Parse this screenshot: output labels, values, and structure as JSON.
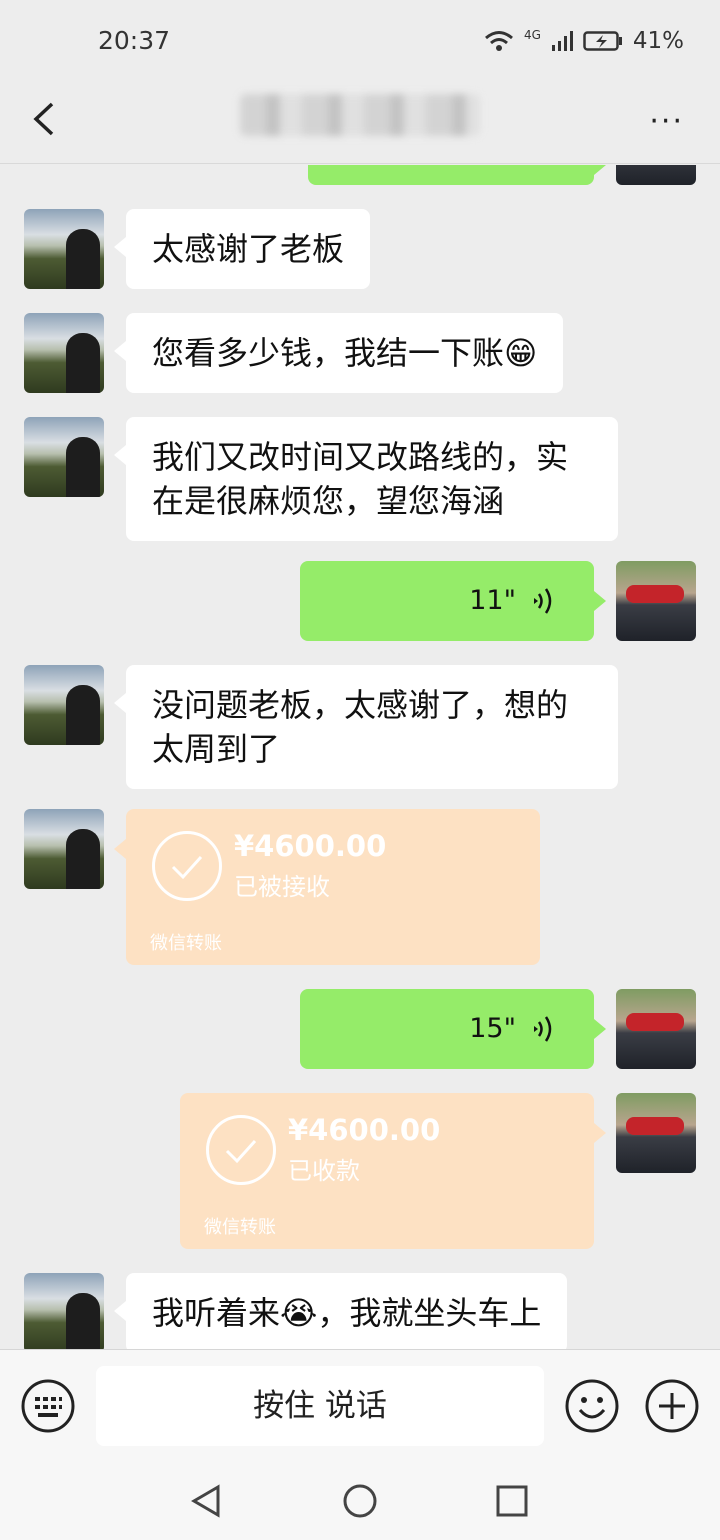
{
  "status_bar": {
    "time": "20:37",
    "network": "4G",
    "battery": "41%"
  },
  "header": {
    "back_icon": "chevron-left-icon",
    "more_label": "···"
  },
  "messages": [
    {
      "from": "other",
      "type": "text",
      "text": "太感谢了老板"
    },
    {
      "from": "other",
      "type": "text",
      "text": "您看多少钱，我结一下账😁"
    },
    {
      "from": "other",
      "type": "text",
      "text": "我们又改时间又改路线的，实在是很麻烦您，望您海涵"
    },
    {
      "from": "self",
      "type": "voice",
      "duration": "11\""
    },
    {
      "from": "other",
      "type": "text",
      "text": "没问题老板，太感谢了，想的太周到了"
    },
    {
      "from": "other",
      "type": "transfer",
      "amount": "¥4600.00",
      "status": "已被接收",
      "brand": "微信转账"
    },
    {
      "from": "self",
      "type": "voice",
      "duration": "15\""
    },
    {
      "from": "self",
      "type": "transfer",
      "amount": "¥4600.00",
      "status": "已收款",
      "brand": "微信转账"
    },
    {
      "from": "other",
      "type": "text",
      "text": "我听着来😭，我就坐头车上"
    }
  ],
  "input_bar": {
    "hold_to_talk": "按住 说话"
  },
  "colors": {
    "self_bubble": "#95ec69",
    "other_bubble": "#ffffff",
    "transfer": "#fde1c3",
    "background": "#ededed"
  }
}
